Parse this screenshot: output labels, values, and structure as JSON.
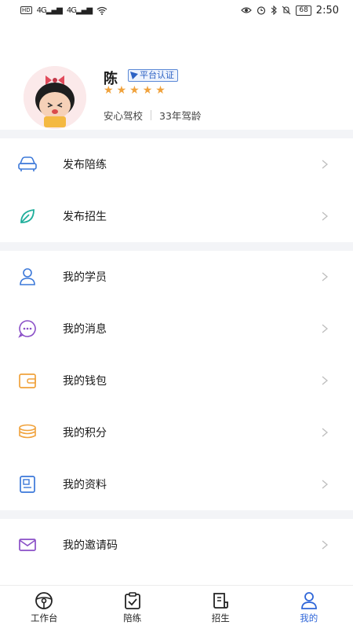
{
  "status_bar": {
    "network_1": "4G",
    "network_2": "4G",
    "battery": "68",
    "time": "2:50"
  },
  "profile": {
    "name": "陈",
    "badge": "平台认证",
    "rating": 5,
    "school": "安心驾校",
    "experience": "33年驾龄"
  },
  "menu": {
    "section1": [
      {
        "label": "发布陪练",
        "icon": "car-icon",
        "color": "#3b78d9"
      },
      {
        "label": "发布招生",
        "icon": "leaf-icon",
        "color": "#1fae9b"
      }
    ],
    "section2": [
      {
        "label": "我的学员",
        "icon": "student-icon",
        "color": "#3b78d9"
      },
      {
        "label": "我的消息",
        "icon": "message-icon",
        "color": "#8a4fc7"
      },
      {
        "label": "我的钱包",
        "icon": "wallet-icon",
        "color": "#f0a23c"
      },
      {
        "label": "我的积分",
        "icon": "coins-icon",
        "color": "#f0a23c"
      },
      {
        "label": "我的资料",
        "icon": "profile-card-icon",
        "color": "#3b78d9"
      }
    ],
    "section3": [
      {
        "label": "我的邀请码",
        "icon": "envelope-icon",
        "color": "#8a4fc7"
      }
    ]
  },
  "tabbar": {
    "tabs": [
      {
        "label": "工作台",
        "icon": "steering-wheel-icon"
      },
      {
        "label": "陪练",
        "icon": "clipboard-check-icon"
      },
      {
        "label": "招生",
        "icon": "document-icon"
      },
      {
        "label": "我的",
        "icon": "user-icon",
        "active": true
      }
    ],
    "active_color": "#2f66d8"
  }
}
